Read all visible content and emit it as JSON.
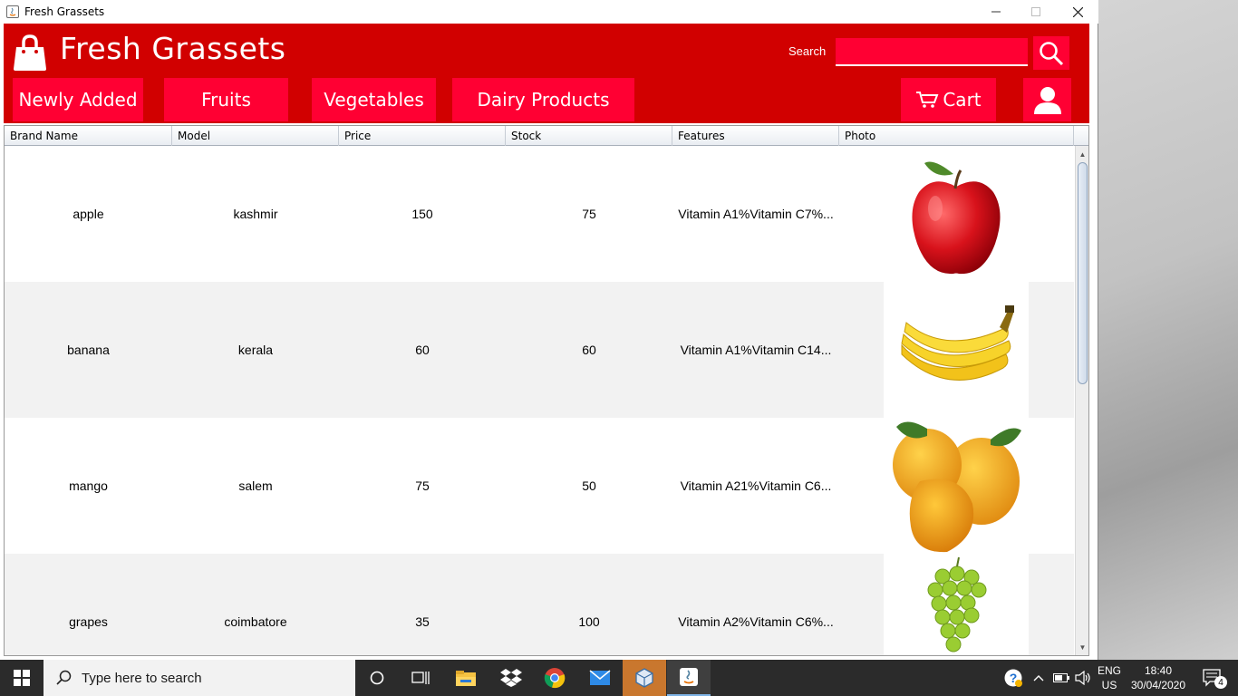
{
  "window": {
    "title": "Fresh Grassets"
  },
  "header": {
    "brand": "Fresh Grassets",
    "search_label": "Search",
    "search_value": "",
    "nav": [
      {
        "label": "Newly Added",
        "name": "nav-newly-added"
      },
      {
        "label": "Fruits",
        "name": "nav-fruits"
      },
      {
        "label": "Vegetables",
        "name": "nav-vegetables"
      },
      {
        "label": "Dairy Products",
        "name": "nav-dairy-products"
      }
    ],
    "cart_label": "Cart"
  },
  "table": {
    "columns": [
      "Brand Name",
      "Model",
      "Price",
      "Stock",
      "Features",
      "Photo"
    ],
    "rows": [
      {
        "brand": "apple",
        "model": "kashmir",
        "price": "150",
        "stock": "75",
        "features": "Vitamin A1%Vitamin C7%...",
        "photo": "apple-icon"
      },
      {
        "brand": "banana",
        "model": "kerala",
        "price": "60",
        "stock": "60",
        "features": "Vitamin A1%Vitamin C14...",
        "photo": "banana-icon"
      },
      {
        "brand": "mango",
        "model": "salem",
        "price": "75",
        "stock": "50",
        "features": "Vitamin A21%Vitamin C6...",
        "photo": "mango-icon"
      },
      {
        "brand": "grapes",
        "model": "coimbatore",
        "price": "35",
        "stock": "100",
        "features": "Vitamin A2%Vitamin C6%...",
        "photo": "grapes-icon"
      }
    ]
  },
  "taskbar": {
    "search_placeholder": "Type here to search",
    "language": "ENG",
    "region": "US",
    "time": "18:40",
    "date": "30/04/2020",
    "notification_count": "4"
  },
  "colors": {
    "header_red": "#d10000",
    "button_red": "#ff0033"
  }
}
